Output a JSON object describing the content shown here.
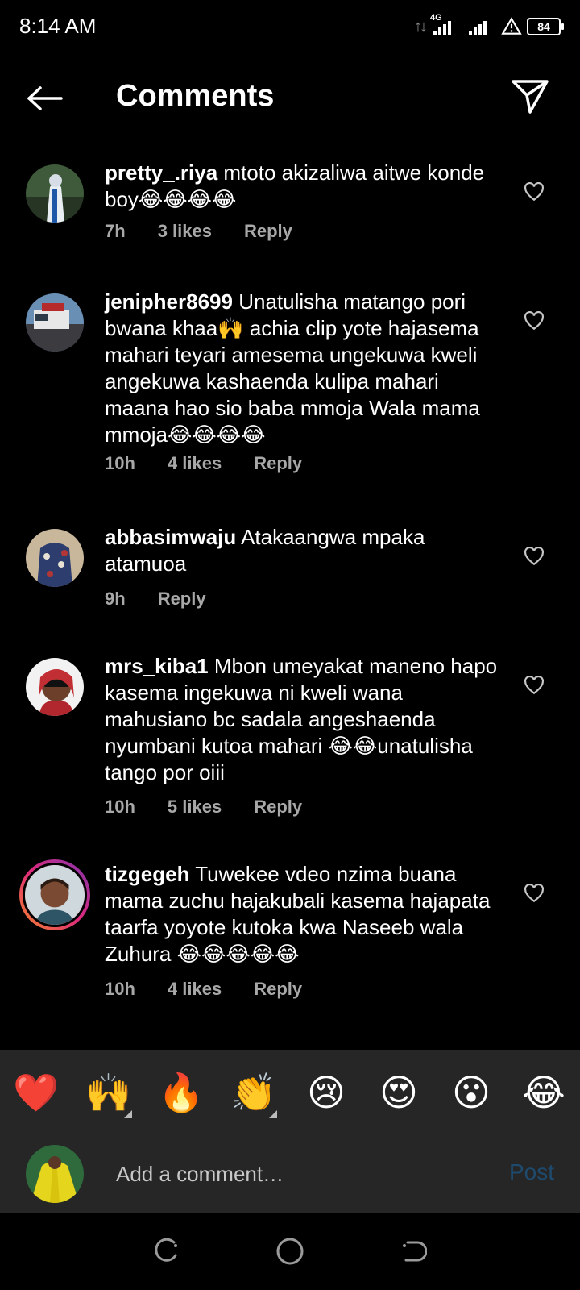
{
  "status_bar": {
    "time": "8:14 AM",
    "network": "4G",
    "battery": "84"
  },
  "header": {
    "title": "Comments",
    "back_icon": "arrow-left-icon",
    "send_icon": "paper-plane-icon"
  },
  "comments": [
    {
      "username": "pretty_.riya",
      "text": " mtoto akizaliwa aitwe konde boy😂😂😂😂",
      "time": "7h",
      "likes": "3 likes",
      "reply": "Reply"
    },
    {
      "username": "jenipher8699",
      "text": " Unatulisha matango pori bwana khaa🙌 achia clip yote hajasema mahari teyari amesema ungekuwa kweli angekuwa kashaenda kulipa mahari maana hao sio baba mmoja Wala mama mmoja😂😂😂😂",
      "time": "10h",
      "likes": "4 likes",
      "reply": "Reply"
    },
    {
      "username": "abbasimwaju",
      "text": " Atakaangwa mpaka atamuoa",
      "time": "9h",
      "likes": "",
      "reply": "Reply"
    },
    {
      "username": "mrs_kiba1",
      "text": " Mbon umeyakat maneno hapo kasema ingekuwa ni kweli wana mahusiano bc sadala angeshaenda nyumbani kutoa mahari 😂😂unatulisha tango por oiii",
      "time": "10h",
      "likes": "5 likes",
      "reply": "Reply"
    },
    {
      "username": "tizgegeh",
      "text": " Tuwekee vdeo nzima buana mama zuchu hajakubali kasema hajapata taarfa yoyote  kutoka kwa Naseeb wala Zuhura 😂😂😂😂😂",
      "time": "10h",
      "likes": "4 likes",
      "reply": "Reply"
    }
  ],
  "emoji_bar": [
    "❤️",
    "🙌",
    "🔥",
    "👏",
    "😢",
    "😍",
    "😮",
    "😂"
  ],
  "add_comment": {
    "placeholder": "Add a comment…",
    "post_label": "Post"
  },
  "colors": {
    "background": "#000000",
    "panel": "#262626",
    "meta_text": "#a8a8a8",
    "post_disabled": "#1e4a6e"
  }
}
